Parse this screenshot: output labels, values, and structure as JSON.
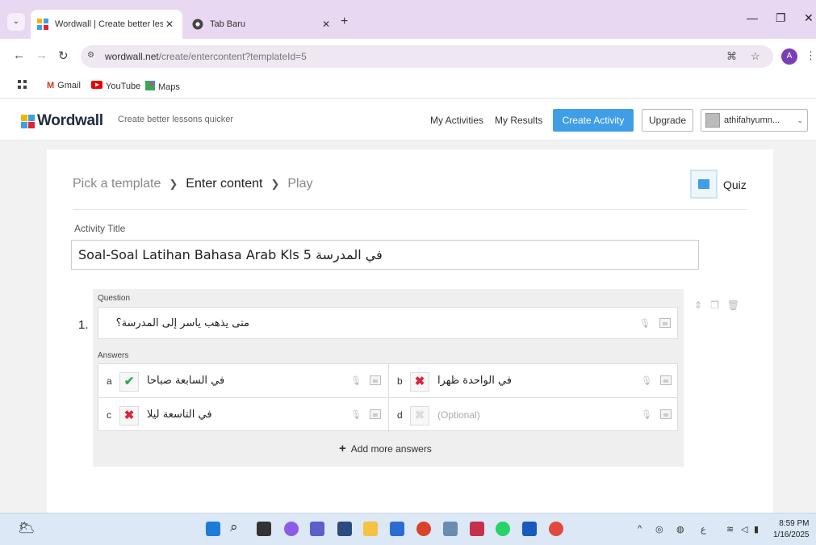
{
  "browser": {
    "tabs": [
      {
        "title": "Wordwall | Create better lessons",
        "active": true
      },
      {
        "title": "Tab Baru",
        "active": false
      }
    ],
    "tab_close": "✕",
    "new_tab": "+",
    "window_controls": {
      "minimize": "—",
      "restore": "❐",
      "close": "✕"
    },
    "url_host": "wordwall.net",
    "url_path": "/create/entercontent?templateId=5",
    "bookmarks": [
      "Gmail",
      "YouTube",
      "Maps"
    ],
    "avatar_letter": "A"
  },
  "header": {
    "brand": "Wordwall",
    "tagline": "Create better lessons quicker",
    "nav": [
      "My Activities",
      "My Results"
    ],
    "create_label": "Create Activity",
    "upgrade_label": "Upgrade",
    "user": "athifahyumn...",
    "accent_color": "#3f9ee6"
  },
  "steps": {
    "pick": "Pick a template",
    "enter": "Enter content",
    "play": "Play",
    "template": "Quiz"
  },
  "activity": {
    "title_label": "Activity Title",
    "title_value": "Soal-Soal Latihan Bahasa Arab Kls 5 في المدرسة"
  },
  "question": {
    "label": "Question",
    "number": "1.",
    "text": "متى يذهب ياسر إلى المدرسة؟",
    "answers_label": "Answers",
    "answers": [
      {
        "letter": "a",
        "text": "في السابعة صباحا",
        "correct": true
      },
      {
        "letter": "b",
        "text": "في الواحدة ظهرا",
        "correct": false
      },
      {
        "letter": "c",
        "text": "في التاسعة ليلا",
        "correct": false
      },
      {
        "letter": "d",
        "text": "",
        "placeholder": "(Optional)",
        "correct": null
      }
    ],
    "add_more": "Add more answers"
  },
  "taskbar": {
    "time": "8:59 PM",
    "date": "1/16/2025"
  }
}
